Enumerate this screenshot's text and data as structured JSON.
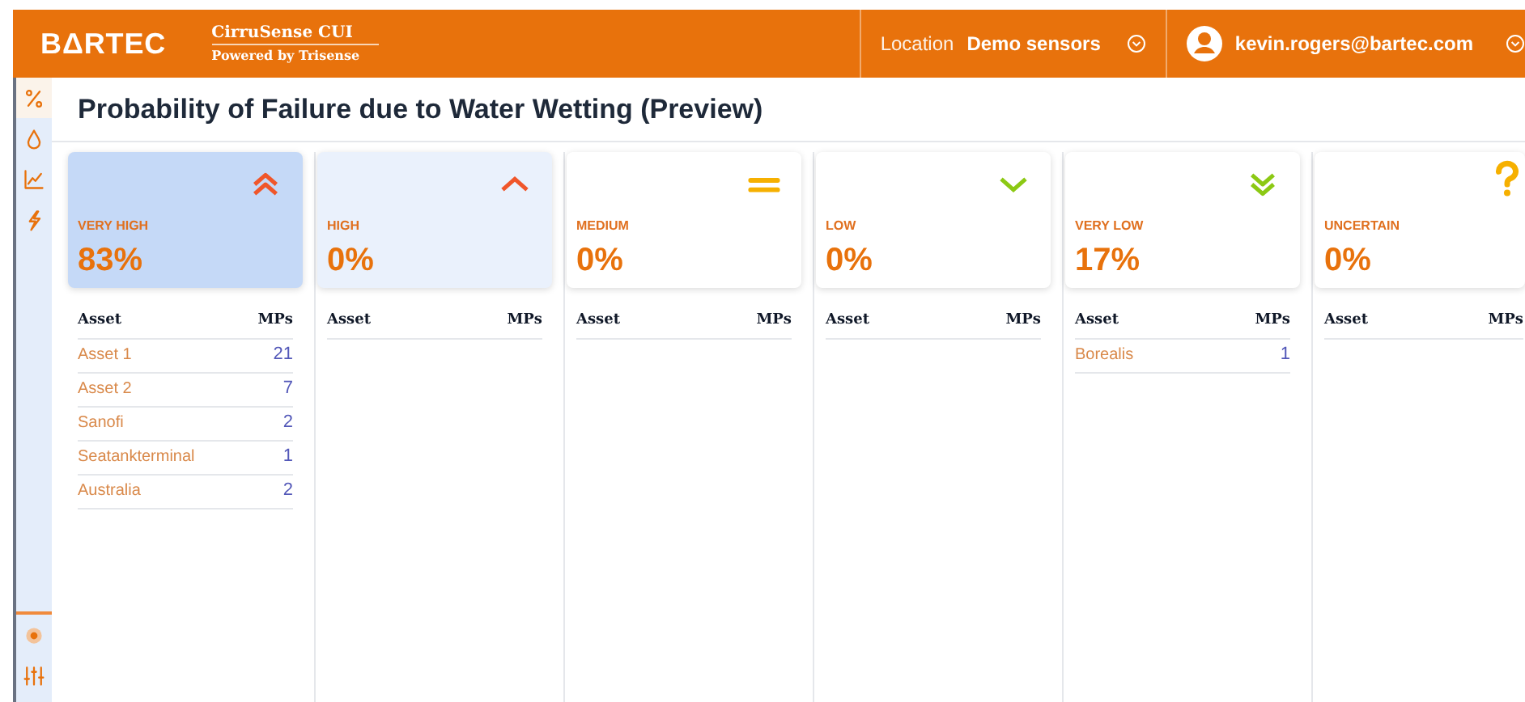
{
  "header": {
    "logo": "BΔRTEC",
    "app_name": "CirruSense CUI",
    "app_subtitle": "Powered by Trisense",
    "location_label": "Location",
    "location_value": "Demo sensors",
    "user": "kevin.rogers@bartec.com"
  },
  "sidebar": {
    "items": [
      {
        "kind": "percent",
        "selected": true
      },
      {
        "kind": "drop",
        "selected": false
      },
      {
        "kind": "chart",
        "selected": false
      },
      {
        "kind": "bolt",
        "selected": false
      }
    ],
    "bottom_items": [
      {
        "kind": "cluster"
      },
      {
        "kind": "sliders"
      }
    ]
  },
  "page_title": "Probability of Failure due to Water Wetting (Preview)",
  "columns": [
    {
      "kind": "double-up",
      "label": "VERY HIGH",
      "value": "83%",
      "color": "#c5d9f7",
      "asset_header": "Asset",
      "mps_header": "MPs",
      "rows": [
        {
          "asset": "Asset 1",
          "mps": "21"
        },
        {
          "asset": "Asset 2",
          "mps": "7"
        },
        {
          "asset": "Sanofi",
          "mps": "2"
        },
        {
          "asset": "Seatankterminal",
          "mps": "1"
        },
        {
          "asset": "Australia",
          "mps": "2"
        }
      ]
    },
    {
      "kind": "up",
      "label": "HIGH",
      "value": "0%",
      "color": "#eaf1fc",
      "asset_header": "Asset",
      "mps_header": "MPs"
    },
    {
      "kind": "equal",
      "label": "MEDIUM",
      "value": "0%",
      "color": "#ffffff",
      "asset_header": "Asset",
      "mps_header": "MPs"
    },
    {
      "kind": "down",
      "label": "LOW",
      "value": "0%",
      "color": "#ffffff",
      "asset_header": "Asset",
      "mps_header": "MPs"
    },
    {
      "kind": "double-down",
      "label": "VERY LOW",
      "value": "17%",
      "color": "#ffffff",
      "asset_header": "Asset",
      "mps_header": "MPs",
      "rows": [
        {
          "asset": "Borealis",
          "mps": "1"
        }
      ]
    },
    {
      "kind": "question",
      "label": "UNCERTAIN",
      "value": "0%",
      "color": "#ffffff",
      "asset_header": "Asset",
      "mps_header": "MPs"
    }
  ]
}
